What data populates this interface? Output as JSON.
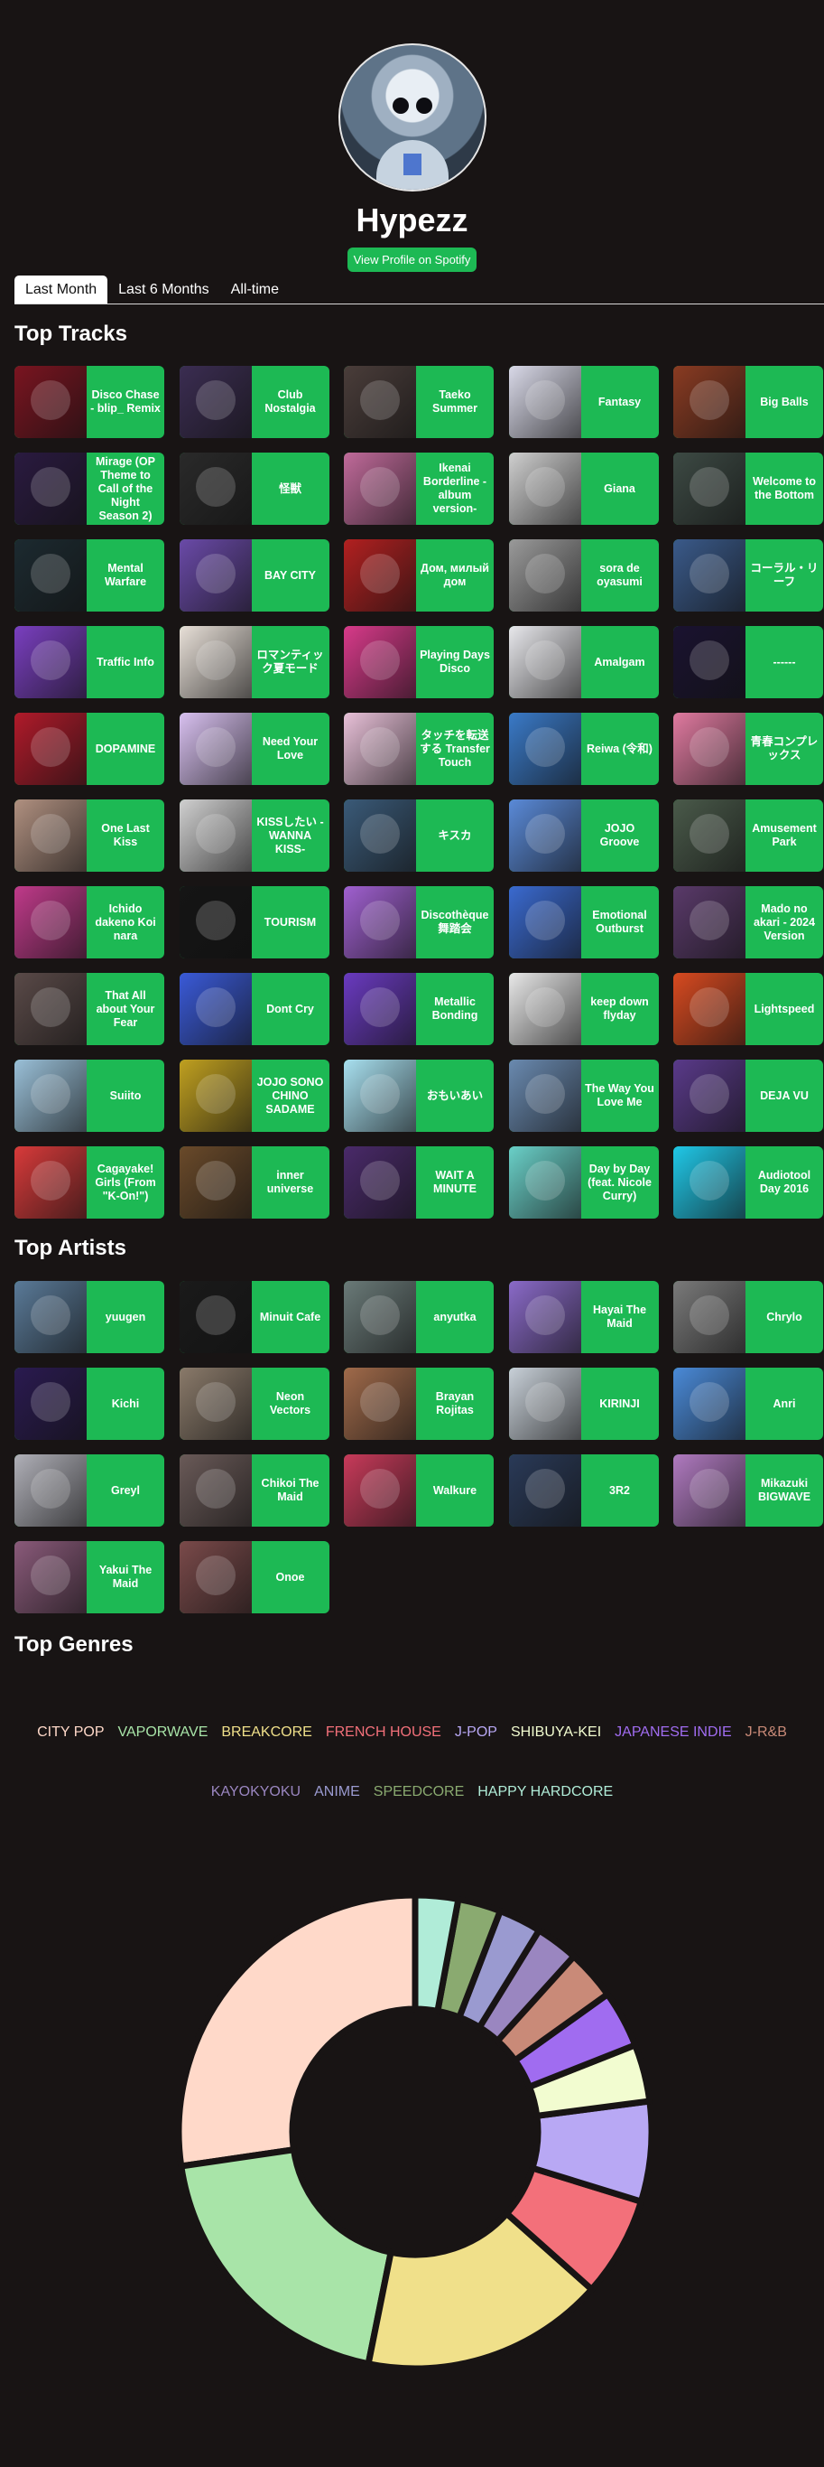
{
  "profile": {
    "username": "Hypezz",
    "view_profile_label": "View Profile on Spotify"
  },
  "tabs": [
    "Last Month",
    "Last 6 Months",
    "All-time"
  ],
  "sections": {
    "top_tracks": "Top Tracks",
    "top_artists": "Top Artists",
    "top_genres": "Top Genres"
  },
  "tracks": [
    {
      "title": "Disco Chase - blip_ Remix",
      "color": "#7a1420"
    },
    {
      "title": "Club Nostalgia",
      "color": "#3b2d52"
    },
    {
      "title": "Taeko Summer",
      "color": "#4a3d3a"
    },
    {
      "title": "Fantasy",
      "color": "#d9d9e8"
    },
    {
      "title": "Big Balls",
      "color": "#8a3b22"
    },
    {
      "title": "Mirage (OP Theme to Call of the Night Season 2)",
      "color": "#2a1a40"
    },
    {
      "title": "怪獣",
      "color": "#2a2a2a"
    },
    {
      "title": "Ikenai Borderline - album version-",
      "color": "#c06a9a"
    },
    {
      "title": "Giana",
      "color": "#cfcfcf"
    },
    {
      "title": "Welcome to the Bottom",
      "color": "#3d4a44"
    },
    {
      "title": "Mental Warfare",
      "color": "#1c2a30"
    },
    {
      "title": "BAY CITY",
      "color": "#6a4aa8"
    },
    {
      "title": "Дом, милый дом",
      "color": "#b22020"
    },
    {
      "title": "sora de oyasumi",
      "color": "#9a9a9a"
    },
    {
      "title": "コーラル・リーフ",
      "color": "#3a5a8a"
    },
    {
      "title": "Traffic Info",
      "color": "#7a3fc0"
    },
    {
      "title": "ロマンティック夏モード",
      "color": "#e8e0d8"
    },
    {
      "title": "Playing Days Disco",
      "color": "#d83a8a"
    },
    {
      "title": "Amalgam",
      "color": "#e8e8ec"
    },
    {
      "title": "------",
      "color": "#1a1230"
    },
    {
      "title": "DOPAMINE",
      "color": "#b01a2a"
    },
    {
      "title": "Need Your Love",
      "color": "#d8c0f0"
    },
    {
      "title": "タッチを転送する Transfer Touch",
      "color": "#e8c0d8"
    },
    {
      "title": "Reiwa (令和)",
      "color": "#3a7ac8"
    },
    {
      "title": "青春コンプレックス",
      "color": "#e07aa0"
    },
    {
      "title": "One Last Kiss",
      "color": "#b09080"
    },
    {
      "title": "KISSしたい - WANNA KISS-",
      "color": "#d0d0d0"
    },
    {
      "title": "キスカ",
      "color": "#3a5a78"
    },
    {
      "title": "JOJO Groove",
      "color": "#5a8ad8"
    },
    {
      "title": "Amusement Park",
      "color": "#4a5a4a"
    },
    {
      "title": "Ichido dakeno Koi nara",
      "color": "#c03a8a"
    },
    {
      "title": "TOURISM",
      "color": "#151515"
    },
    {
      "title": "Discothèque舞踏会",
      "color": "#a060d0"
    },
    {
      "title": "Emotional Outburst",
      "color": "#3a6ad0"
    },
    {
      "title": "Mado no akari - 2024 Version",
      "color": "#5a3a6a"
    },
    {
      "title": "That All about Your Fear",
      "color": "#5a4a48"
    },
    {
      "title": "Dont Cry",
      "color": "#3a5ad8"
    },
    {
      "title": "Metallic Bonding",
      "color": "#6a3ac0"
    },
    {
      "title": "keep down flyday",
      "color": "#e8e8e8"
    },
    {
      "title": "Lightspeed",
      "color": "#d84a20"
    },
    {
      "title": "Suiito",
      "color": "#9ac0d8"
    },
    {
      "title": "JOJO SONO CHINO SADAME",
      "color": "#c0a020"
    },
    {
      "title": "おもいあい",
      "color": "#a8e0f0"
    },
    {
      "title": "The Way You Love Me",
      "color": "#6a8ab0"
    },
    {
      "title": "DEJA VU",
      "color": "#5a3a8a"
    },
    {
      "title": "Cagayake! Girls (From \"K-On!\")",
      "color": "#d83a3a"
    },
    {
      "title": "inner universe",
      "color": "#6a4a2a"
    },
    {
      "title": "WAIT A MINUTE",
      "color": "#4a2a6a"
    },
    {
      "title": "Day by Day (feat. Nicole Curry)",
      "color": "#6ad0c8"
    },
    {
      "title": "Audiotool Day 2016",
      "color": "#20c8e8"
    }
  ],
  "artists": [
    {
      "name": "yuugen",
      "color": "#5a7a98"
    },
    {
      "name": "Minuit Cafe",
      "color": "#1a1a1a"
    },
    {
      "name": "anyutka",
      "color": "#6a7a78"
    },
    {
      "name": "Hayai The Maid",
      "color": "#8a6ac8"
    },
    {
      "name": "Chrylo",
      "color": "#7a7a7a"
    },
    {
      "name": "Kichi",
      "color": "#2a1a50"
    },
    {
      "name": "Neon Vectors",
      "color": "#8a7a6a"
    },
    {
      "name": "Brayan Rojitas",
      "color": "#a06a4a"
    },
    {
      "name": "KIRINJI",
      "color": "#c8d0d8"
    },
    {
      "name": "Anri",
      "color": "#4a8ad8"
    },
    {
      "name": "Greyl",
      "color": "#b0b0b8"
    },
    {
      "name": "Chikoi The Maid",
      "color": "#6a5a58"
    },
    {
      "name": "Walkure",
      "color": "#c83a5a"
    },
    {
      "name": "3R2",
      "color": "#2a3a58"
    },
    {
      "name": "Mikazuki BIGWAVE",
      "color": "#b07ac0"
    },
    {
      "name": "Yakui The Maid",
      "color": "#8a5a7a"
    },
    {
      "name": "Onoe",
      "color": "#7a4a4a"
    }
  ],
  "genres": [
    {
      "name": "CITY POP",
      "color": "#ffd9c9"
    },
    {
      "name": "VAPORWAVE",
      "color": "#a8e4a8"
    },
    {
      "name": "BREAKCORE",
      "color": "#f0e08a"
    },
    {
      "name": "FRENCH HOUSE",
      "color": "#f3707a"
    },
    {
      "name": "J-POP",
      "color": "#b8a8f4"
    },
    {
      "name": "SHIBUYA-KEI",
      "color": "#f2fcd0"
    },
    {
      "name": "JAPANESE INDIE",
      "color": "#a06cf0"
    },
    {
      "name": "J-R&B",
      "color": "#c98a78"
    },
    {
      "name": "KAYOKYOKU",
      "color": "#9a86c0"
    },
    {
      "name": "ANIME",
      "color": "#9a9ad0"
    },
    {
      "name": "SPEEDCORE",
      "color": "#8aaa70"
    },
    {
      "name": "HAPPY HARDCORE",
      "color": "#b0ecd8"
    }
  ],
  "chart_data": {
    "type": "pie",
    "categories": [
      "CITY POP",
      "VAPORWAVE",
      "BREAKCORE",
      "FRENCH HOUSE",
      "J-POP",
      "SHIBUYA-KEI",
      "JAPANESE INDIE",
      "J-R&B",
      "KAYOKYOKU",
      "ANIME",
      "SPEEDCORE",
      "HAPPY HARDCORE"
    ],
    "values": [
      28,
      20,
      17,
      7,
      7,
      4,
      4,
      3.5,
      3,
      3,
      3,
      3
    ],
    "colors": [
      "#ffd9c9",
      "#a8e4a8",
      "#f0e08a",
      "#f3707a",
      "#b8a8f4",
      "#f2fcd0",
      "#a06cf0",
      "#c98a78",
      "#9a86c0",
      "#9a9ad0",
      "#8aaa70",
      "#b0ecd8"
    ],
    "start_angle_deg": 90,
    "direction": "counterclockwise",
    "donut": true,
    "legend": "top"
  }
}
